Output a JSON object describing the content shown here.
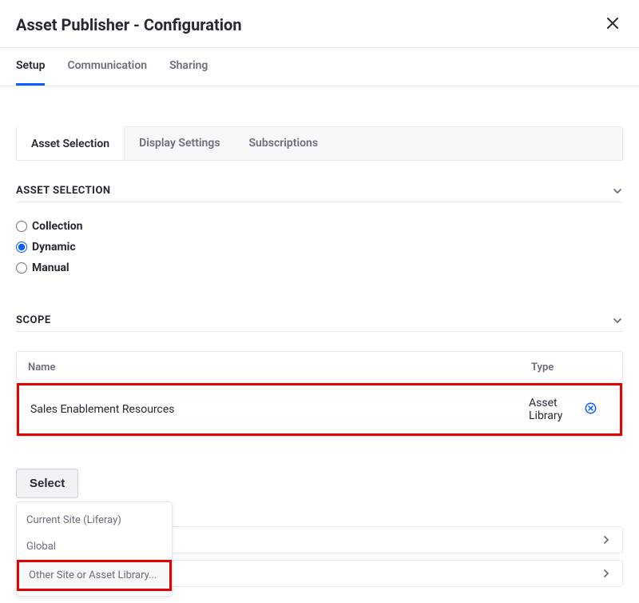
{
  "header": {
    "title": "Asset Publisher - Configuration"
  },
  "main_tabs": [
    "Setup",
    "Communication",
    "Sharing"
  ],
  "inner_tabs": [
    "Asset Selection",
    "Display Settings",
    "Subscriptions"
  ],
  "section_asset_selection": {
    "title": "ASSET SELECTION",
    "options": [
      "Collection",
      "Dynamic",
      "Manual"
    ],
    "selected": "Dynamic"
  },
  "section_scope": {
    "title": "SCOPE",
    "table": {
      "headers": {
        "name": "Name",
        "type": "Type"
      },
      "rows": [
        {
          "name": "Sales Enablement Resources",
          "type": "Asset Library"
        }
      ]
    }
  },
  "select_button": "Select",
  "dropdown_items": [
    "Current Site (Liferay)",
    "Global",
    "Other Site or Asset Library..."
  ]
}
